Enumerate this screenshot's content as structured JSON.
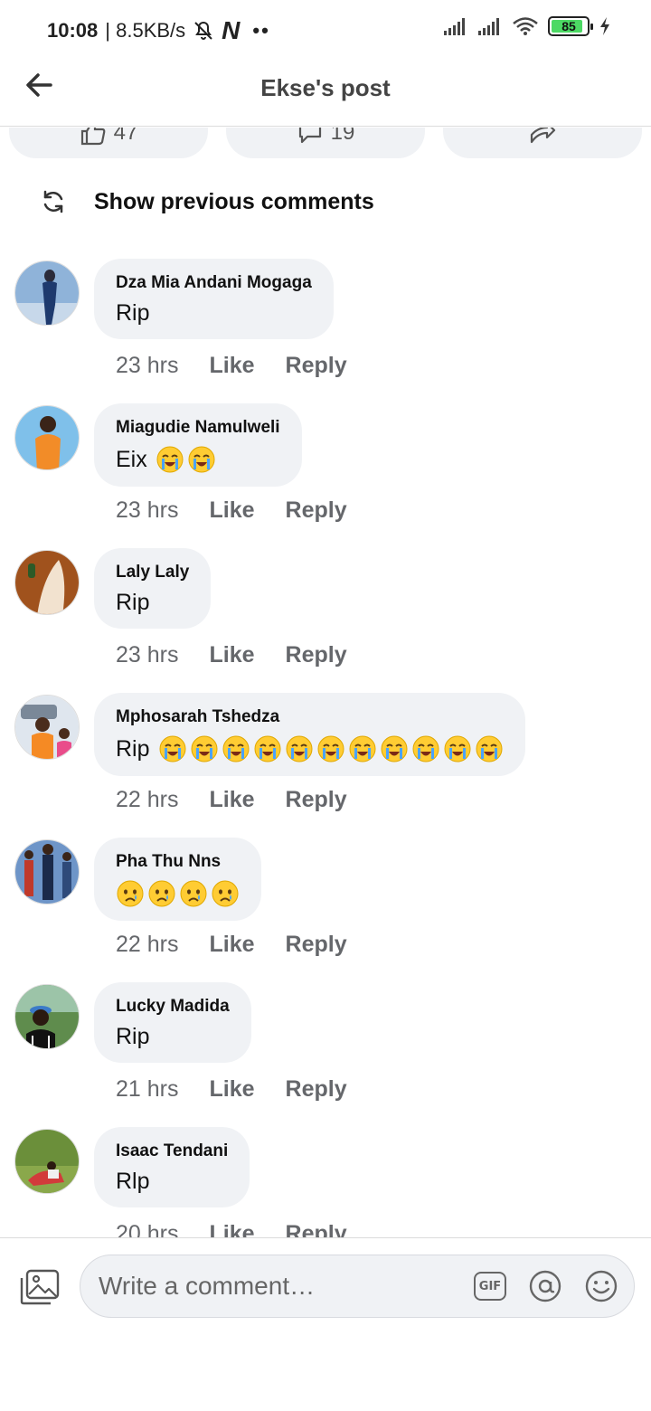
{
  "status_bar": {
    "time": "10:08",
    "speed": "| 8.5KB/s",
    "battery": "85",
    "dots": "••"
  },
  "header": {
    "title": "Ekse's post"
  },
  "reactions": {
    "likes": "47",
    "comments": "19"
  },
  "show_previous": {
    "label": "Show previous comments"
  },
  "actions": {
    "like": "Like",
    "reply": "Reply"
  },
  "comments": [
    {
      "author": "Dza Mia Andani Mogaga",
      "text": "Rip",
      "emoji_count": 0,
      "emoji_type": "",
      "time": "23 hrs"
    },
    {
      "author": "Miagudie Namulweli",
      "text": "Eix",
      "emoji_count": 2,
      "emoji_type": "crying",
      "time": "23 hrs"
    },
    {
      "author": "Laly Laly",
      "text": "Rip",
      "emoji_count": 0,
      "emoji_type": "",
      "time": "23 hrs"
    },
    {
      "author": "Mphosarah Tshedza",
      "text": "Rip",
      "emoji_count": 11,
      "emoji_type": "crying",
      "time": "22 hrs"
    },
    {
      "author": "Pha Thu Nns",
      "text": "",
      "emoji_count": 4,
      "emoji_type": "sad",
      "time": "22 hrs"
    },
    {
      "author": "Lucky Madida",
      "text": "Rip",
      "emoji_count": 0,
      "emoji_type": "",
      "time": "21 hrs"
    },
    {
      "author": "Isaac Tendani",
      "text": "Rlp",
      "emoji_count": 0,
      "emoji_type": "",
      "time": "20 hrs"
    }
  ],
  "composer": {
    "placeholder": "Write a comment…",
    "gif_label": "GIF"
  },
  "colors": {
    "bubble_bg": "#f0f2f5",
    "meta_text": "#65676b",
    "battery_fill": "#4cd964"
  }
}
